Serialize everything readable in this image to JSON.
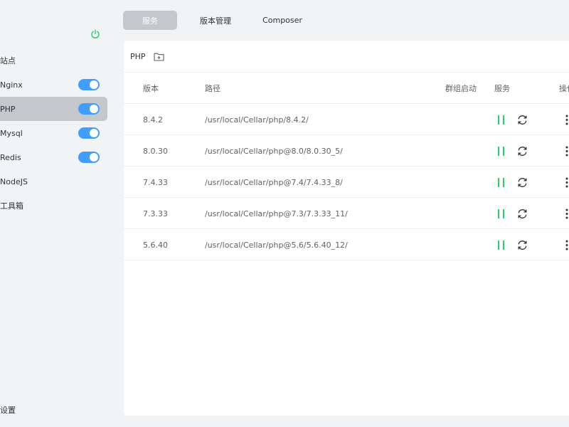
{
  "sidebar": {
    "items": [
      {
        "label": "站点",
        "toggle": null
      },
      {
        "label": "Nginx",
        "toggle": true
      },
      {
        "label": "PHP",
        "toggle": true,
        "active": true
      },
      {
        "label": "Mysql",
        "toggle": true
      },
      {
        "label": "Redis",
        "toggle": true
      },
      {
        "label": "NodeJS",
        "toggle": null
      },
      {
        "label": "工具箱",
        "toggle": null
      }
    ],
    "settings": "设置"
  },
  "tabs": [
    {
      "label": "服务",
      "active": true
    },
    {
      "label": "版本管理"
    },
    {
      "label": "Composer"
    }
  ],
  "panel": {
    "title": "PHP",
    "columns": {
      "version": "版本",
      "path": "路径",
      "group_start": "群组启动",
      "service": "服务",
      "operation": "操作"
    },
    "rows": [
      {
        "version": "8.4.2",
        "path": "/usr/local/Cellar/php/8.4.2/"
      },
      {
        "version": "8.0.30",
        "path": "/usr/local/Cellar/php@8.0/8.0.30_5/"
      },
      {
        "version": "7.4.33",
        "path": "/usr/local/Cellar/php@7.4/7.4.33_8/"
      },
      {
        "version": "7.3.33",
        "path": "/usr/local/Cellar/php@7.3/7.3.33_11/"
      },
      {
        "version": "5.6.40",
        "path": "/usr/local/Cellar/php@5.6/5.6.40_12/"
      }
    ]
  },
  "icons": {
    "power": "power-icon",
    "folder_add": "folder-add-icon",
    "pause": "pause-icon",
    "reload": "reload-icon",
    "more": "more-vertical-icon"
  },
  "colors": {
    "accent": "#409eff",
    "running": "#2ecc71",
    "active_bg": "#c4c7cc"
  }
}
